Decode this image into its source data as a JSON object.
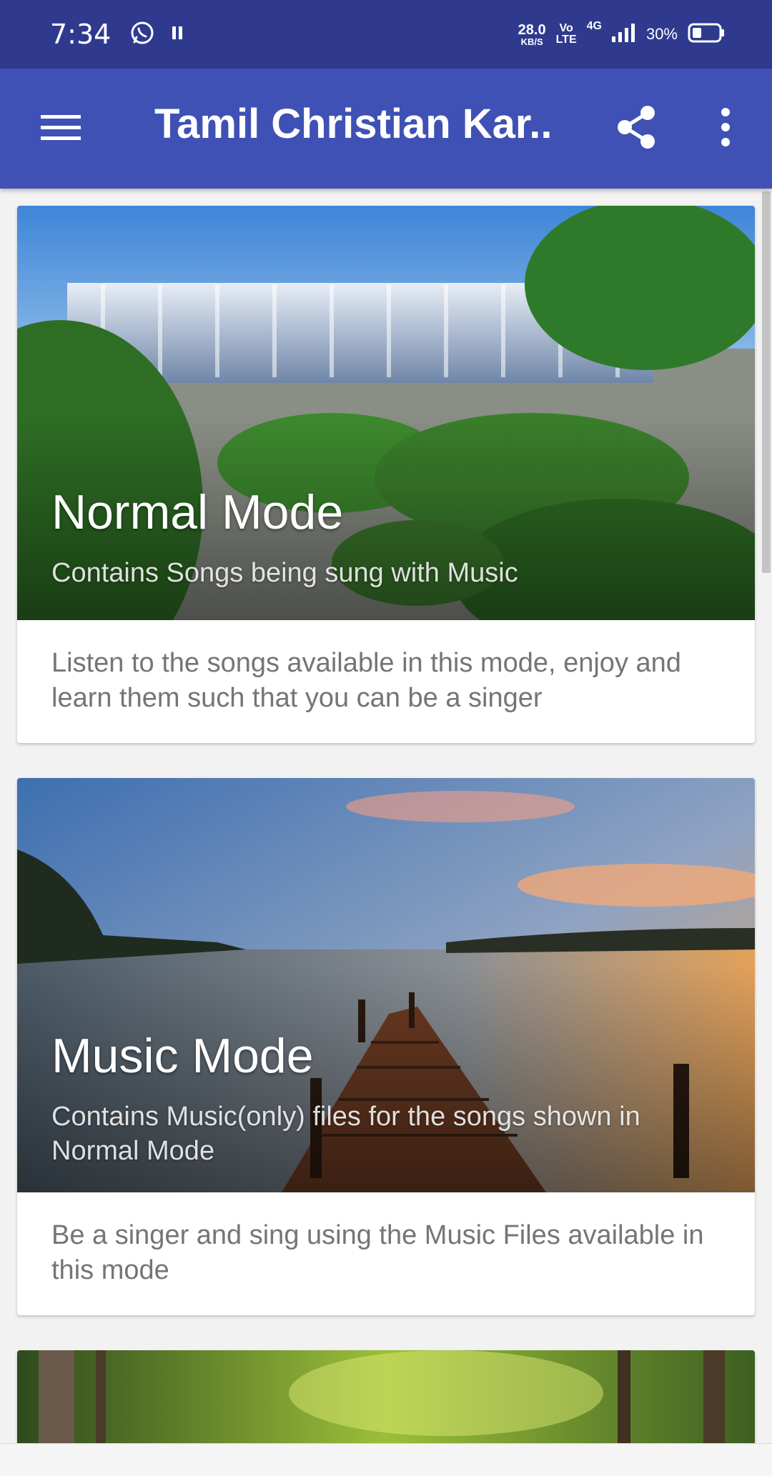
{
  "status_bar": {
    "time": "7:34",
    "speed_value": "28.0",
    "speed_unit": "KB/S",
    "volte_top": "Vo",
    "volte_bottom": "LTE",
    "network": "4G",
    "battery": "30%",
    "icons": [
      "whatsapp-icon",
      "pause-icon",
      "signal-icon",
      "battery-icon"
    ]
  },
  "app_bar": {
    "title": "Tamil Christian Kar...",
    "icons": [
      "menu-icon",
      "share-icon",
      "more-vert-icon"
    ]
  },
  "colors": {
    "status_bar": "#2f3a8e",
    "app_bar": "#3f51b5",
    "card_text": "#757575"
  },
  "cards": [
    {
      "title": "Normal Mode",
      "subtitle": "Contains Songs being sung with Music",
      "description": "Listen to the songs available in this mode, enjoy and learn them such that you can be a singer",
      "image": "waterfall-image"
    },
    {
      "title": "Music Mode",
      "subtitle": "Contains Music(only) files for the songs shown in Normal Mode",
      "description": "Be a singer and sing using the Music Files available in this mode",
      "image": "lake-pier-sunset-image"
    },
    {
      "image": "forest-image"
    }
  ]
}
